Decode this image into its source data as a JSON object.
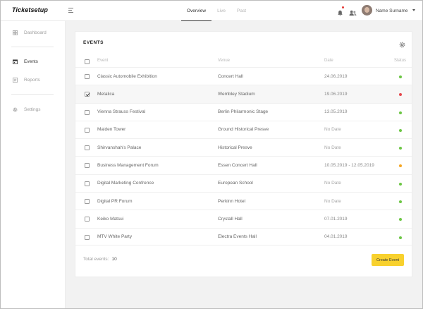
{
  "app": {
    "logo": "Ticketsetup"
  },
  "topnav": {
    "tabs": [
      {
        "label": "Overview",
        "active": true
      },
      {
        "label": "Live",
        "active": false
      },
      {
        "label": "Past",
        "active": false
      }
    ],
    "user_name": "Name Surname"
  },
  "sidebar": {
    "items": [
      {
        "label": "Dashboard",
        "icon": "dashboard-icon",
        "active": false
      },
      {
        "label": "Events",
        "icon": "calendar-icon",
        "active": true
      },
      {
        "label": "Reports",
        "icon": "reports-icon",
        "active": false
      },
      {
        "label": "Settings",
        "icon": "gear-icon",
        "active": false
      }
    ]
  },
  "events_card": {
    "title": "EVENTS",
    "columns": {
      "event": "Event",
      "venue": "Venue",
      "date": "Date",
      "status": "Status"
    },
    "rows": [
      {
        "event": "Classic Automobile Exhibition",
        "venue": "Concert Hall",
        "date": "24.06.2019",
        "status": "green",
        "checked": false
      },
      {
        "event": "Metalica",
        "venue": "Wembley Stadium",
        "date": "19.06.2019",
        "status": "red",
        "checked": true
      },
      {
        "event": "Vienna Strauss Festival",
        "venue": "Berlin Philarmonic Stage",
        "date": "13.05.2019",
        "status": "green",
        "checked": false
      },
      {
        "event": "Maiden Tower",
        "venue": "Ground Historical Presve",
        "date": "No Date",
        "status": "green",
        "checked": false
      },
      {
        "event": "Shirvanshah's Palace",
        "venue": "Historical Presve",
        "date": "No Date",
        "status": "green",
        "checked": false
      },
      {
        "event": "Business Management Forum",
        "venue": "Essen Concert Hall",
        "date": "10.05.2019 - 12.05.2019",
        "status": "orange",
        "checked": false
      },
      {
        "event": "Digital Marketing Confrence",
        "venue": "European School",
        "date": "No Date",
        "status": "green",
        "checked": false
      },
      {
        "event": "Digital PR Forum",
        "venue": "Perkinn Hotel",
        "date": "No Date",
        "status": "green",
        "checked": false
      },
      {
        "event": "Keiko Matsui",
        "venue": "Crystall Hall",
        "date": "07.01.2019",
        "status": "green",
        "checked": false
      },
      {
        "event": "MTV White Party",
        "venue": "Electra Events Hall",
        "date": "04.01.2019",
        "status": "green",
        "checked": false
      }
    ],
    "total_label": "Total events:",
    "total_value": "10",
    "create_button": "Create Event"
  },
  "colors": {
    "accent": "#f8d12e",
    "status_green": "#6cc644",
    "status_red": "#e5484d",
    "status_orange": "#f5a623"
  }
}
